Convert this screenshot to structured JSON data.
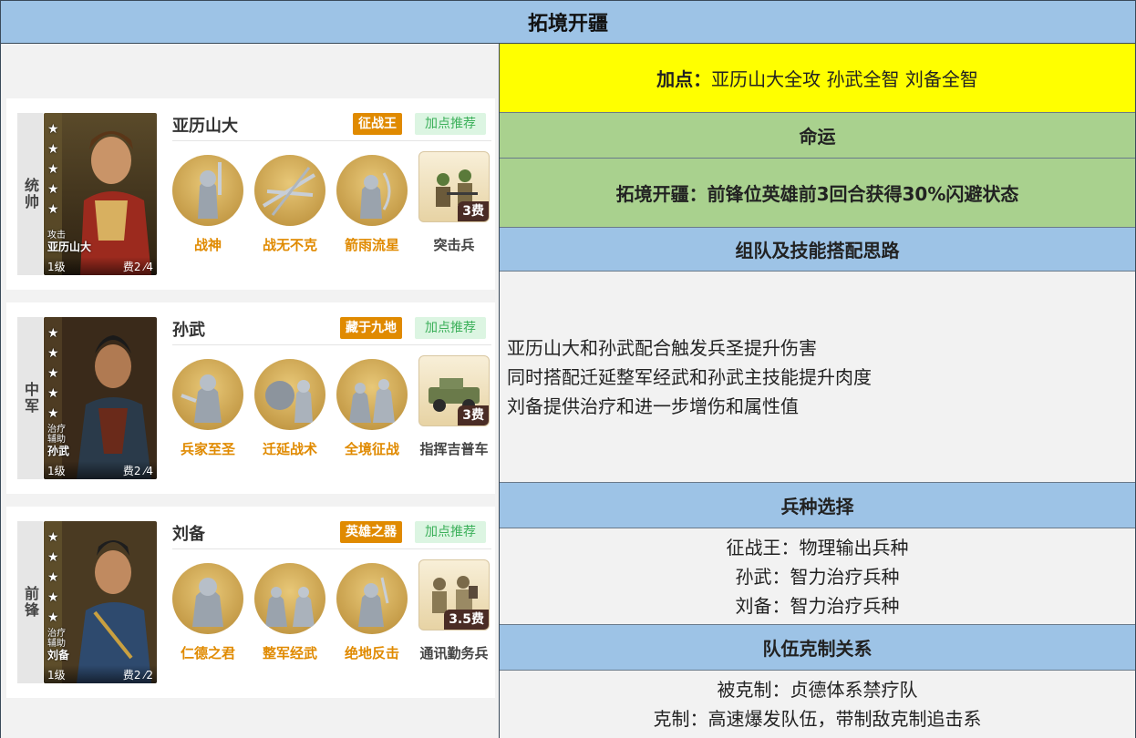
{
  "page_title": "拓境开疆",
  "heroes": [
    {
      "role": "统帅",
      "name": "亚历山大",
      "tag": "征战王",
      "recommend": "加点推荐",
      "portrait_tags": [
        "攻击"
      ],
      "portrait_name": "亚历山大",
      "level": "1级",
      "cost": "费2",
      "power": "4",
      "skills": [
        "战神",
        "战无不克",
        "箭雨流星"
      ],
      "troop": {
        "name": "突击兵",
        "cost": "3费"
      }
    },
    {
      "role": "中军",
      "name": "孙武",
      "tag": "藏于九地",
      "recommend": "加点推荐",
      "portrait_tags": [
        "治疗",
        "辅助"
      ],
      "portrait_name": "孙武",
      "level": "1级",
      "cost": "费2",
      "power": "4",
      "skills": [
        "兵家至圣",
        "迁延战术",
        "全境征战"
      ],
      "troop": {
        "name": "指挥吉普车",
        "cost": "3费"
      }
    },
    {
      "role": "前锋",
      "name": "刘备",
      "tag": "英雄之器",
      "recommend": "加点推荐",
      "portrait_tags": [
        "治疗",
        "辅助"
      ],
      "portrait_name": "刘备",
      "level": "1级",
      "cost": "费2",
      "power": "2",
      "skills": [
        "仁德之君",
        "整军经武",
        "绝地反击"
      ],
      "troop": {
        "name": "通讯勤务兵",
        "cost": "3.5费"
      }
    }
  ],
  "right": {
    "points_label": "加点：",
    "points_text": "亚历山大全攻 孙武全智 刘备全智",
    "fate_header": "命运",
    "fate_text": "拓境开疆：前锋位英雄前3回合获得30%闪避状态",
    "team_header": "组队及技能搭配思路",
    "team_lines": [
      "亚历山大和孙武配合触发兵圣提升伤害",
      "同时搭配迁延整军经武和孙武主技能提升肉度",
      "刘备提供治疗和进一步增伤和属性值"
    ],
    "troops_header": "兵种选择",
    "troops_lines": [
      "征战王：物理输出兵种",
      "孙武：智力治疗兵种",
      "刘备：智力治疗兵种"
    ],
    "counter_header": "队伍克制关系",
    "counter_lines": [
      "被克制：贞德体系禁疗队",
      "克制：高速爆发队伍，带制敌克制追击系"
    ]
  },
  "colors": {
    "header_blue": "#9dc3e6",
    "highlight_yellow": "#ffff00",
    "fate_green": "#a9d18e",
    "skill_gold": "#e08a00",
    "recommend_green": "#3cb05a"
  }
}
